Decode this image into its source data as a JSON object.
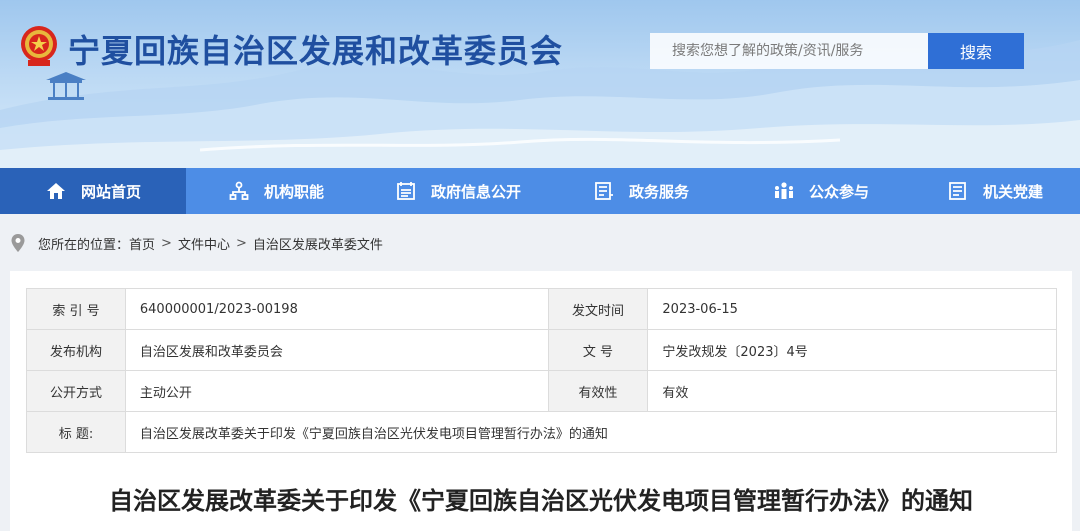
{
  "header": {
    "site_title": "宁夏回族自治区发展和改革委员会",
    "search_placeholder": "搜索您想了解的政策/资讯/服务",
    "search_button": "搜索"
  },
  "nav": {
    "items": [
      {
        "label": "网站首页",
        "icon": "home-icon",
        "active": true
      },
      {
        "label": "机构职能",
        "icon": "org-chart-icon",
        "active": false
      },
      {
        "label": "政府信息公开",
        "icon": "newspaper-icon",
        "active": false
      },
      {
        "label": "政务服务",
        "icon": "list-icon",
        "active": false
      },
      {
        "label": "公众参与",
        "icon": "people-icon",
        "active": false
      },
      {
        "label": "机关党建",
        "icon": "document-icon",
        "active": false
      }
    ]
  },
  "breadcrumb": {
    "prefix": "您所在的位置：",
    "items": [
      "首页",
      "文件中心",
      "自治区发展改革委文件"
    ],
    "separator": ">"
  },
  "meta": {
    "index_label": "索 引 号",
    "index_value": "640000001/2023-00198",
    "date_label": "发文时间",
    "date_value": "2023-06-15",
    "issuer_label": "发布机构",
    "issuer_value": "自治区发展和改革委员会",
    "docno_label": "文 号",
    "docno_value": "宁发改规发〔2023〕4号",
    "open_label": "公开方式",
    "open_value": "主动公开",
    "valid_label": "有效性",
    "valid_value": "有效",
    "title_label": "标 题:",
    "title_value": "自治区发展改革委关于印发《宁夏回族自治区光伏发电项目管理暂行办法》的通知"
  },
  "document": {
    "title": "自治区发展改革委关于印发《宁夏回族自治区光伏发电项目管理暂行办法》的通知"
  },
  "colors": {
    "nav_bg": "#4d8de6",
    "nav_active": "#2a62b8",
    "title_blue": "#1f4fa0",
    "search_button": "#2f6fd6"
  }
}
